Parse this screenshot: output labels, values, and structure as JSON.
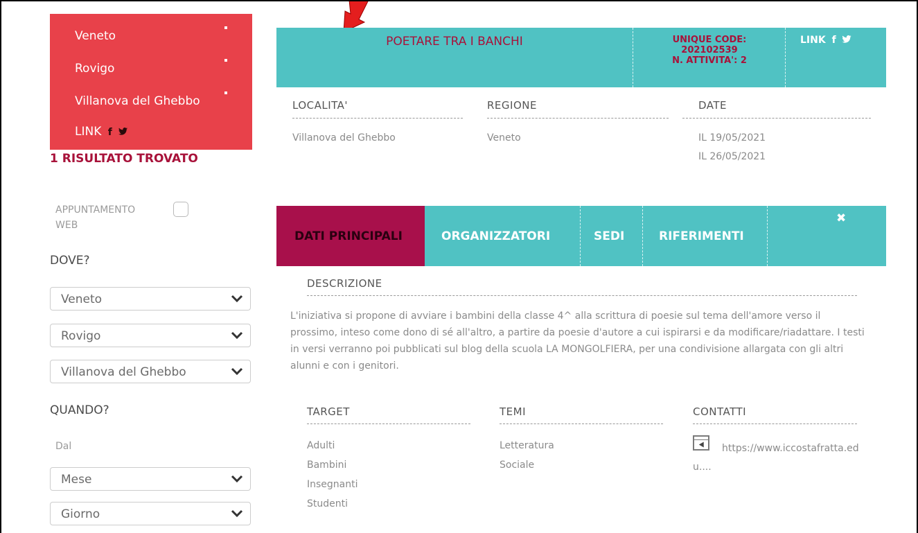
{
  "sidebar": {
    "location_filters": [
      "Veneto",
      "Rovigo",
      "Villanova del Ghebbo"
    ],
    "link_label": "LINK",
    "social_icons": [
      "facebook-icon",
      "twitter-icon"
    ],
    "results_text": "1 RISULTATO TROVATO",
    "appointment_label": "APPUNTAMENTO WEB",
    "appointment_checked": false,
    "dove_title": "DOVE?",
    "region_select": "Veneto",
    "province_select": "Rovigo",
    "city_select": "Villanova del Ghebbo",
    "quando_title": "QUANDO?",
    "dal_label": "Dal",
    "month_select": "Mese",
    "day_select": "Giorno"
  },
  "event": {
    "title": "POETARE TRA I BANCHI",
    "unique_code_label": "UNIQUE CODE:",
    "unique_code": "202102539",
    "activities": "N. ATTIVITA': 2",
    "link_label": "LINK",
    "localita_header": "LOCALITA'",
    "localita_value": "Villanova del Ghebbo",
    "regione_header": "REGIONE",
    "regione_value": "Veneto",
    "date_header": "DATE",
    "dates": [
      "IL 19/05/2021",
      "IL 26/05/2021"
    ]
  },
  "tabs": [
    "DATI PRINCIPALI",
    "ORGANIZZATORI",
    "SEDI",
    "RIFERIMENTI"
  ],
  "active_tab": "DATI PRINCIPALI",
  "details": {
    "descrizione_header": "DESCRIZIONE",
    "descrizione_text": "L'iniziativa si propone di avviare i bambini della classe 4^ alla scrittura di poesie sul tema dell'amore verso il prossimo, inteso come dono di sé all'altro, a partire da poesie d'autore a cui ispirarsi e da modificare/riadattare. I testi in versi verranno poi pubblicati sul blog della scuola LA MONGOLFIERA, per una condivisione allargata con gli altri alunni e con i genitori.",
    "target_header": "TARGET",
    "targets": [
      "Adulti",
      "Bambini",
      "Insegnanti",
      "Studenti"
    ],
    "temi_header": "TEMI",
    "temi": [
      "Letteratura",
      "Sociale"
    ],
    "contatti_header": "CONTATTI",
    "contact_url": "https://www.iccostafratta.edu...."
  },
  "colors": {
    "teal": "#50c2c3",
    "red": "#e8414a",
    "magenta": "#a8104b",
    "arrow": "#e41e1e"
  }
}
